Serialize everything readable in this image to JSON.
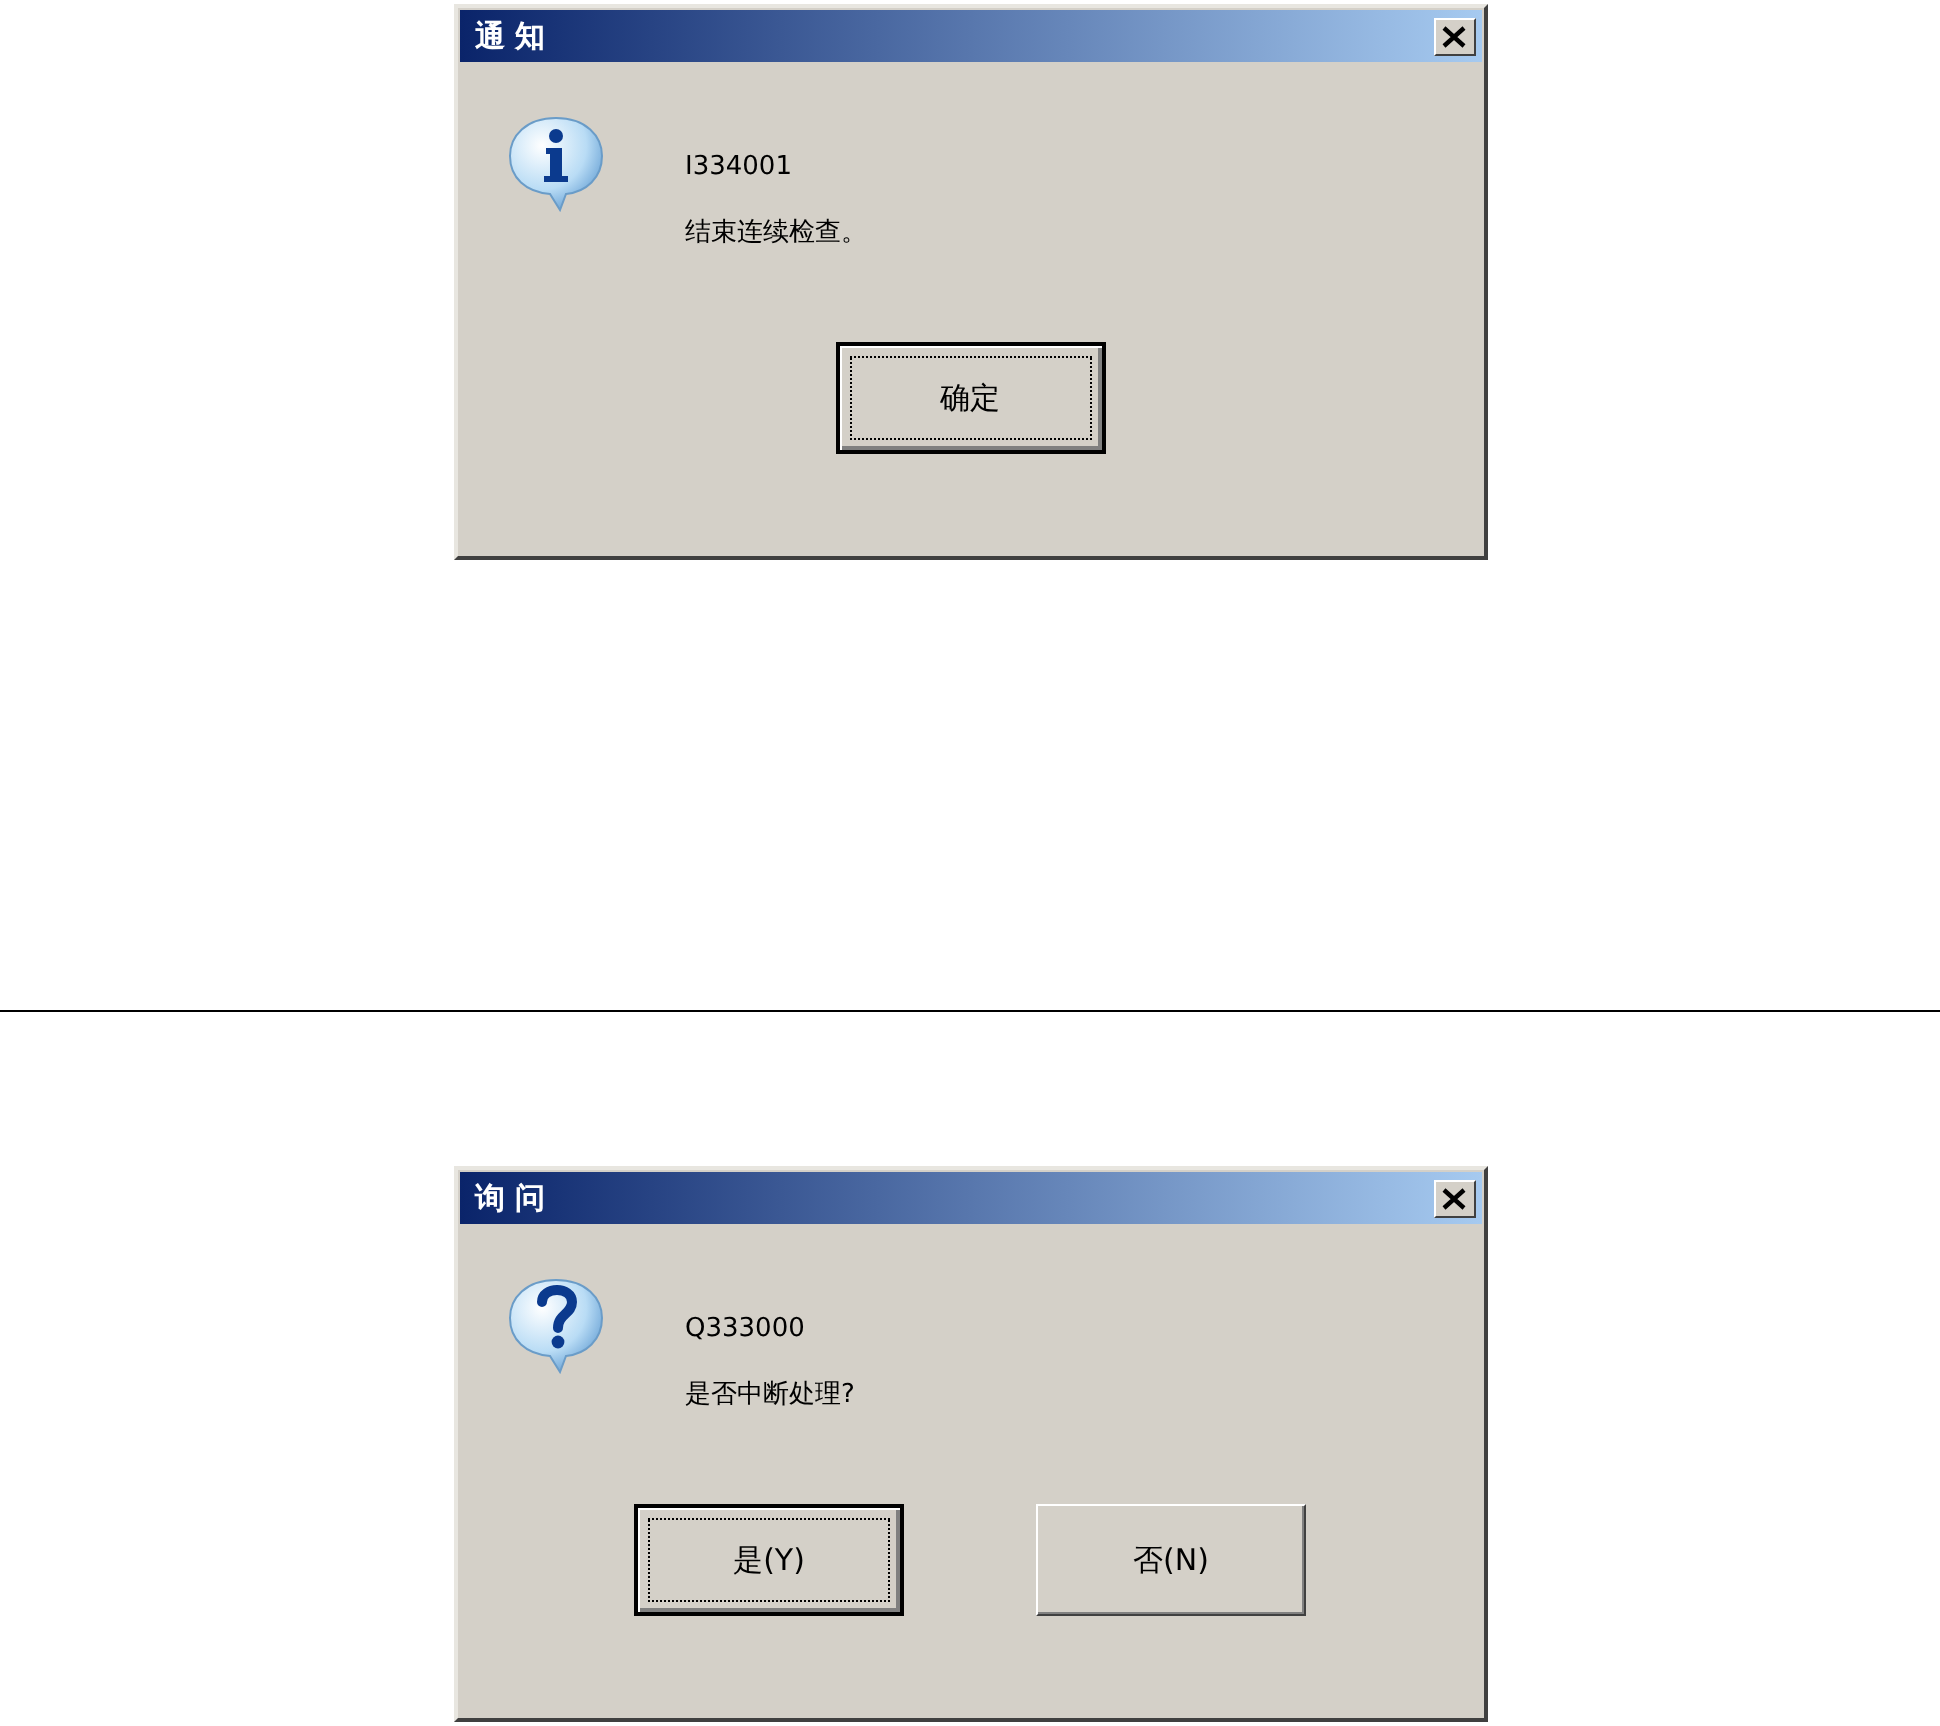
{
  "dialogs": [
    {
      "title": "通 知",
      "kind": "info",
      "code": "I334001",
      "message": "结束连续检查。",
      "buttons": [
        {
          "label": "确定",
          "default": true
        }
      ]
    },
    {
      "title": "询 问",
      "kind": "question",
      "code": "Q333000",
      "message": "是否中断处理?",
      "buttons": [
        {
          "label": "是(Y)",
          "default": true
        },
        {
          "label": "否(N)",
          "default": false
        }
      ]
    }
  ]
}
